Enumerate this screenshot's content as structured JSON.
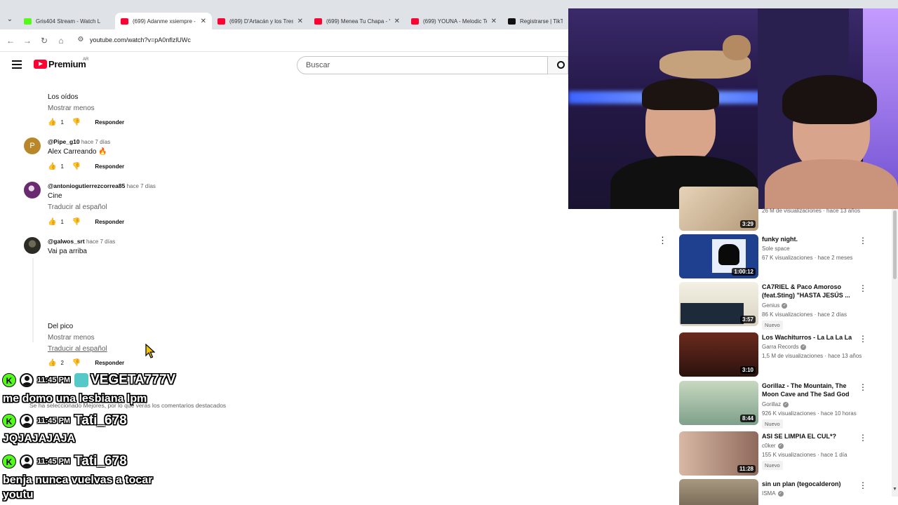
{
  "browser": {
    "tabs": [
      {
        "title": "Gris404 Stream - Watch L",
        "favicon": "kick",
        "active": false
      },
      {
        "title": "(699) Adanme xsiempre -",
        "favicon": "youtube",
        "active": true
      },
      {
        "title": "(699) D'Artacán y los Tres",
        "favicon": "youtube",
        "active": false
      },
      {
        "title": "(699) Menea Tu Chapa - Y",
        "favicon": "youtube",
        "active": false
      },
      {
        "title": "(699) YOUNA - Melodic Te",
        "favicon": "youtube",
        "active": false
      },
      {
        "title": "Registrarse | TikTok",
        "favicon": "tiktok",
        "active": false
      }
    ],
    "close_glyph": "✕",
    "url": "youtube.com/watch?v=pA0nflzlUWc"
  },
  "header": {
    "brand": "Premium",
    "country": "AR",
    "search_placeholder": "Buscar"
  },
  "comments": [
    {
      "text": "Los oídos",
      "show_less": "Mostrar menos",
      "likes": "1",
      "reply": "Responder"
    },
    {
      "handle": "@Pipe_g10",
      "time": "hace 7 días",
      "avatar_letter": "P",
      "text": "Alex Carreando 🔥",
      "likes": "1",
      "reply": "Responder"
    },
    {
      "handle": "@antoniogutierrezcorrea85",
      "time": "hace 7 días",
      "text": "Cine",
      "translate": "Traducir al español",
      "likes": "1",
      "reply": "Responder"
    },
    {
      "handle": "@galwos_srt",
      "time": "hace 7 días",
      "text_top": "Vai pa arriba",
      "text_bottom": "Del pico",
      "show_less": "Mostrar menos",
      "translate": "Traducir al español",
      "likes": "2",
      "reply": "Responder"
    }
  ],
  "sort_note": "Se ha seleccionado Mejores, por lo que verás los comentarios destacados",
  "chat": {
    "messages": [
      {
        "time": "11:45 PM",
        "user": "VEGETA777V",
        "message": "me domo una lesbiana lpm"
      },
      {
        "time": "11:45 PM",
        "user": "Tati_678",
        "message": "JQJAJAJAJA"
      },
      {
        "time": "11:45 PM",
        "user": "Tati_678",
        "message": "benja nunca vuelvas a tocar"
      }
    ],
    "trailing_line": "youtu"
  },
  "sidebar": {
    "videos": [
      {
        "title": "",
        "channel": "",
        "stats": "26 M de visualizaciones · hace 13 años",
        "duration": "3:29",
        "badge": ""
      },
      {
        "title": "funky night.",
        "channel": "Sole space",
        "verified": false,
        "stats": "67 K visualizaciones · hace 2 meses",
        "duration": "1:00:12",
        "badge": ""
      },
      {
        "title": "CA7RIEL & Paco Amoroso (feat.Sting) \"HASTA JESÚS ...",
        "channel": "Genius",
        "verified": true,
        "stats": "86 K visualizaciones · hace 2 días",
        "duration": "3:57",
        "badge": "Nuevo"
      },
      {
        "title": "Los Wachiturros - La La La La",
        "channel": "Garra Records",
        "verified": true,
        "stats": "1,5 M de visualizaciones · hace 13 años",
        "duration": "3:10",
        "badge": ""
      },
      {
        "title": "Gorillaz - The Mountain, The Moon Cave and The Sad God",
        "channel": "Gorillaz",
        "verified": true,
        "stats": "926 K visualizaciones · hace 10 horas",
        "duration": "8:44",
        "badge": "Nuevo"
      },
      {
        "title": "ASI SE LIMPIA EL CUL*?",
        "channel": "c0ker",
        "verified": true,
        "stats": "155 K visualizaciones · hace 1 día",
        "duration": "11:28",
        "badge": "Nuevo"
      },
      {
        "title": "sin un plan (tegocalderon)",
        "channel": "ISMA",
        "verified": true,
        "stats": "",
        "duration": "",
        "badge": ""
      }
    ]
  },
  "colors": {
    "youtube_red": "#ff0033",
    "kick_green": "#53fc18",
    "tab_strip": "#dfe3e8"
  }
}
